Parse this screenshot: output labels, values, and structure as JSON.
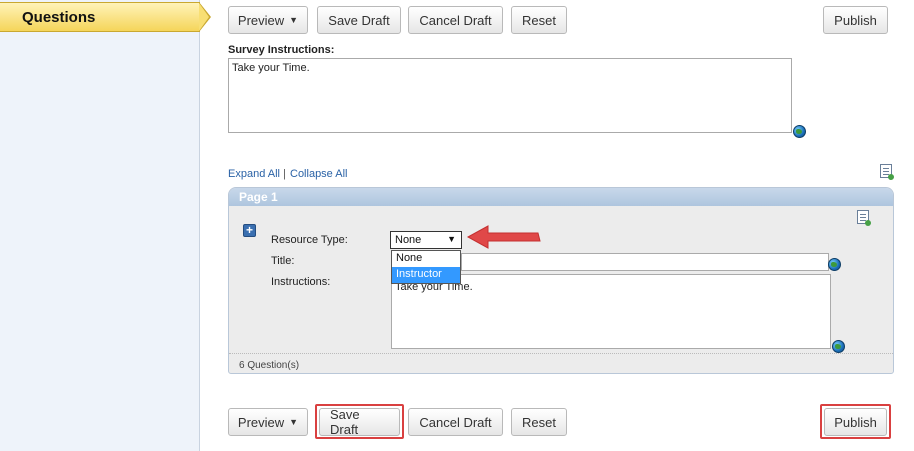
{
  "sidebar": {
    "active_tab_label": "Questions"
  },
  "toolbar_top": {
    "preview_label": "Preview",
    "save_draft_label": "Save Draft",
    "cancel_draft_label": "Cancel Draft",
    "reset_label": "Reset",
    "publish_label": "Publish"
  },
  "survey": {
    "instructions_label": "Survey Instructions:",
    "instructions_value": "Take your Time."
  },
  "expand_collapse": {
    "expand_label": "Expand All",
    "separator": "|",
    "collapse_label": "Collapse All"
  },
  "page": {
    "header": "Page 1",
    "resource_type_label": "Resource Type:",
    "resource_type_value": "None",
    "resource_type_options": [
      "None",
      "Instructor"
    ],
    "resource_type_highlighted": "Instructor",
    "title_label": "Title:",
    "instructions_label": "Instructions:",
    "instructions_value": "Take your Time.",
    "question_count": "6 Question(s)"
  },
  "toolbar_bottom": {
    "preview_label": "Preview",
    "save_draft_label": "Save Draft",
    "cancel_draft_label": "Cancel Draft",
    "reset_label": "Reset",
    "publish_label": "Publish"
  },
  "colors": {
    "highlight_red": "#d94040",
    "dropdown_selected": "#3399ff",
    "tab_yellow": "#f5d55a"
  },
  "icons": {
    "globe": "globe-icon",
    "expand": "plus-square-icon",
    "add_page": "add-document-icon"
  }
}
